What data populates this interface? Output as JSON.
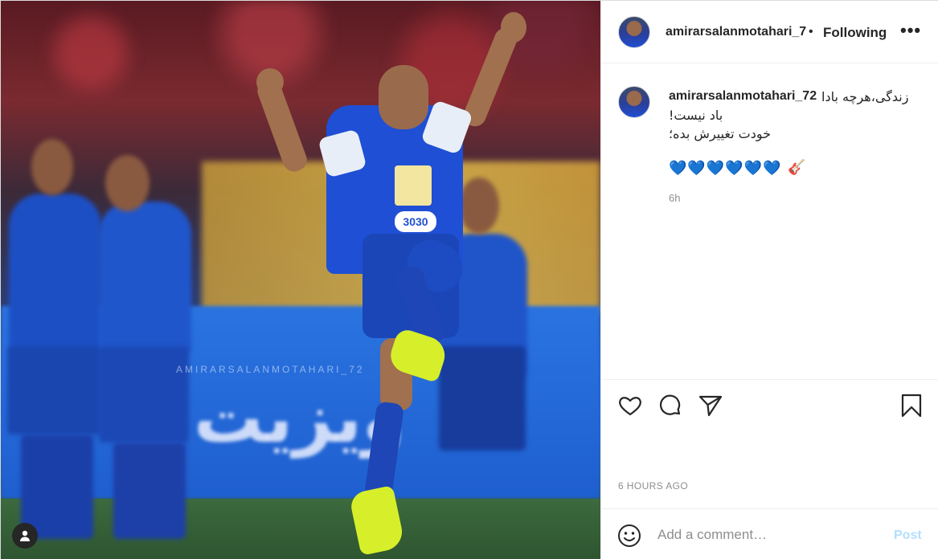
{
  "post": {
    "watermark": "AMIRARSALANMOTAHARI_72",
    "jersey_number": "3030"
  },
  "header": {
    "username": "amirarsalanmotahari_7",
    "separator": "•",
    "follow_label": "Following",
    "more_label": "•••"
  },
  "caption": {
    "username": "amirarsalanmotahari_72",
    "line1": "زندگی،هرچه بادا",
    "line2": "باد نیست!",
    "line3": "خودت تغییرش بده؛",
    "hearts": "💙💙💙💙💙💙",
    "guitar": "🎸",
    "age": "6h"
  },
  "actions": {
    "like_icon": "heart-icon",
    "comment_icon": "comment-icon",
    "share_icon": "paper-plane-icon",
    "save_icon": "bookmark-icon"
  },
  "timestamp": "6 HOURS AGO",
  "comment": {
    "placeholder": "Add a comment…",
    "post_label": "Post"
  },
  "colors": {
    "link_blue": "#0095f6",
    "post_disabled": "#b2dffc",
    "muted": "#8e8e8e",
    "text": "#262626"
  }
}
